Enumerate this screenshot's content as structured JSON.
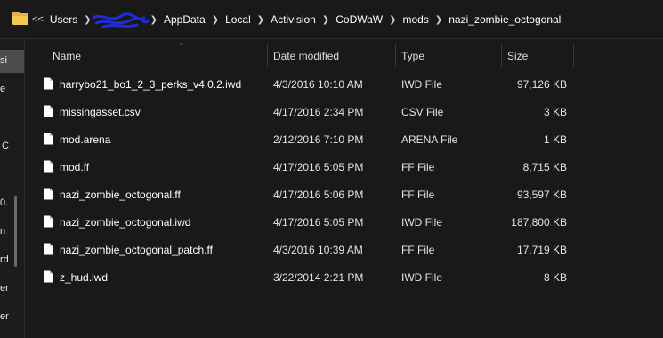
{
  "address": {
    "overflow": "<<",
    "crumbs": [
      "Users",
      "AppData",
      "Local",
      "Activision",
      "CoDWaW",
      "mods",
      "nazi_zombie_octogonal"
    ]
  },
  "columns": {
    "name": "Name",
    "date": "Date modified",
    "type": "Type",
    "size": "Size"
  },
  "files": [
    {
      "name": "harrybo21_bo1_2_3_perks_v4.0.2.iwd",
      "date": "4/3/2016 10:10 AM",
      "type": "IWD File",
      "size": "97,126 KB"
    },
    {
      "name": "missingasset.csv",
      "date": "4/17/2016 2:34 PM",
      "type": "CSV File",
      "size": "3 KB"
    },
    {
      "name": "mod.arena",
      "date": "2/12/2016 7:10 PM",
      "type": "ARENA File",
      "size": "1 KB"
    },
    {
      "name": "mod.ff",
      "date": "4/17/2016 5:05 PM",
      "type": "FF File",
      "size": "8,715 KB"
    },
    {
      "name": "nazi_zombie_octogonal.ff",
      "date": "4/17/2016 5:06 PM",
      "type": "FF File",
      "size": "93,597 KB"
    },
    {
      "name": "nazi_zombie_octogonal.iwd",
      "date": "4/17/2016 5:05 PM",
      "type": "IWD File",
      "size": "187,800 KB"
    },
    {
      "name": "nazi_zombie_octogonal_patch.ff",
      "date": "4/3/2016 10:39 AM",
      "type": "FF File",
      "size": "17,719 KB"
    },
    {
      "name": "z_hud.iwd",
      "date": "3/22/2014 2:21 PM",
      "type": "IWD File",
      "size": "8 KB"
    }
  ],
  "nav_fragments": [
    "si",
    "e",
    "C",
    "0.",
    "n",
    "rd",
    "er",
    "er"
  ],
  "colors": {
    "background": "#191919",
    "folder": "#f4c04f",
    "redaction": "#1f2bd8"
  }
}
